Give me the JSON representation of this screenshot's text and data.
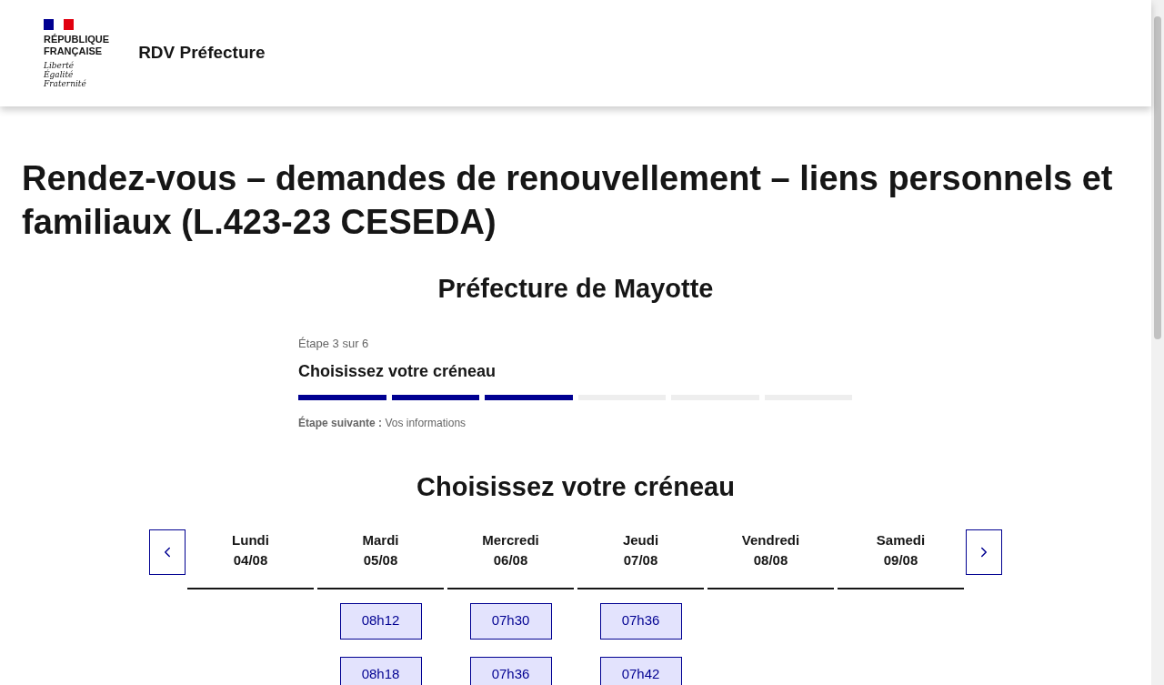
{
  "header": {
    "logo_lines": [
      "RÉPUBLIQUE",
      "FRANÇAISE"
    ],
    "motto": [
      "Liberté",
      "Égalité",
      "Fraternité"
    ],
    "site_title": "RDV Préfecture"
  },
  "page_title": "Rendez-vous – demandes de renouvellement – liens personnels et familiaux (L.423-23 CESEDA)",
  "subtitle": "Préfecture de Mayotte",
  "stepper": {
    "step_count": "Étape 3 sur 6",
    "current_title": "Choisissez votre créneau",
    "next_label": "Étape suivante :",
    "next_value": "Vos informations",
    "steps": [
      {
        "completed": true
      },
      {
        "completed": true
      },
      {
        "completed": true
      },
      {
        "completed": false
      },
      {
        "completed": false
      },
      {
        "completed": false
      }
    ]
  },
  "slots_title": "Choisissez votre créneau",
  "days": [
    {
      "name": "Lundi",
      "date": "04/08"
    },
    {
      "name": "Mardi",
      "date": "05/08",
      "slots": [
        "08h12",
        "08h18"
      ]
    },
    {
      "name": "Mercredi",
      "date": "06/08",
      "slots": [
        "07h30",
        "07h36"
      ]
    },
    {
      "name": "Jeudi",
      "date": "07/08",
      "slots": [
        "07h36",
        "07h42"
      ]
    },
    {
      "name": "Vendredi",
      "date": "08/08"
    },
    {
      "name": "Samedi",
      "date": "09/08"
    }
  ]
}
